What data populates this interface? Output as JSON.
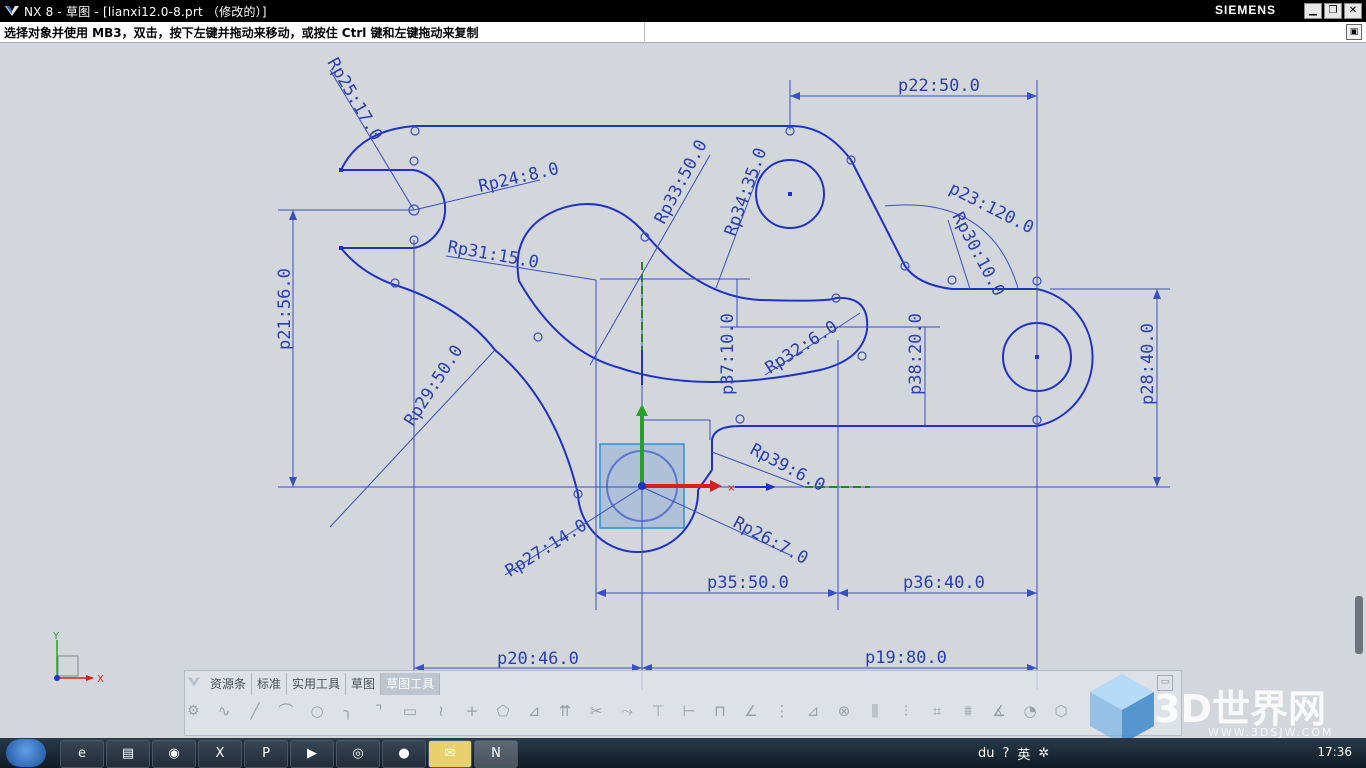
{
  "window": {
    "title": "NX 8 - 草图 - [lianxi12.0-8.prt （修改的）]",
    "brand": "SIEMENS",
    "min_icon": "minimize-icon",
    "restore_icon": "restore-icon",
    "close_icon": "close-icon"
  },
  "status": {
    "message": "选择对象并使用 MB3，双击，按下左键并拖动来移动，或按住 Ctrl 键和左键拖动来复制"
  },
  "dimensions": {
    "p22": "p22:50.0",
    "rp25": "Rp25:17.0",
    "rp24": "Rp24:8.0",
    "rp33": "Rp33:50.0",
    "rp34": "Rp34:35.0",
    "p23": "p23:120.0",
    "rp30": "Rp30:10.0",
    "rp31": "Rp31:15.0",
    "p21": "p21:56.0",
    "p37": "p37:10.0",
    "rp32": "Rp32:6.0",
    "p38": "p38:20.0",
    "p28": "p28:40.0",
    "rp29": "Rp29:50.0",
    "rp39": "Rp39:6.0",
    "rp26": "Rp26:7.0",
    "rp27": "Rp27:14.0",
    "p35": "p35:50.0",
    "p36": "p36:40.0",
    "p20": "p20:46.0",
    "p19": "p19:80.0"
  },
  "axis_labels": {
    "x": "X",
    "y": "Y"
  },
  "toolbar": {
    "tabs": [
      "资源条",
      "标准",
      "实用工具",
      "草图",
      "草图工具"
    ],
    "active_tab": "草图工具",
    "icons": [
      "profile-icon",
      "line-icon",
      "arc-icon",
      "circle-icon",
      "fillet-icon",
      "chamfer-icon",
      "rectangle-icon",
      "studio-spline-icon",
      "point-icon",
      "offset-icon",
      "pattern-icon",
      "derived-line-icon",
      "quick-trim-icon",
      "quick-extend-icon",
      "make-corner-icon",
      "constraint-icon",
      "auto-dimension-icon",
      "relations-icon",
      "mirror-icon",
      "convert-icon",
      "alternate-icon",
      "display-constraints-icon",
      "inferred-icon",
      "rapid-dimension-icon",
      "linear-dim-icon",
      "angular-dim-icon",
      "radial-dim-icon",
      "perimeter-icon"
    ]
  },
  "watermark": {
    "text": "3D世界网",
    "sub": "WWW.3DSJW.COM"
  },
  "taskbar": {
    "apps": [
      "ie-icon",
      "explorer-icon",
      "qq-icon",
      "excel-icon",
      "powerpoint-icon",
      "video-icon",
      "chrome-icon",
      "player-icon",
      "wechat-icon",
      "nx-icon"
    ],
    "tray": [
      "du",
      "?",
      "英",
      "✲"
    ],
    "time": "17:36"
  }
}
